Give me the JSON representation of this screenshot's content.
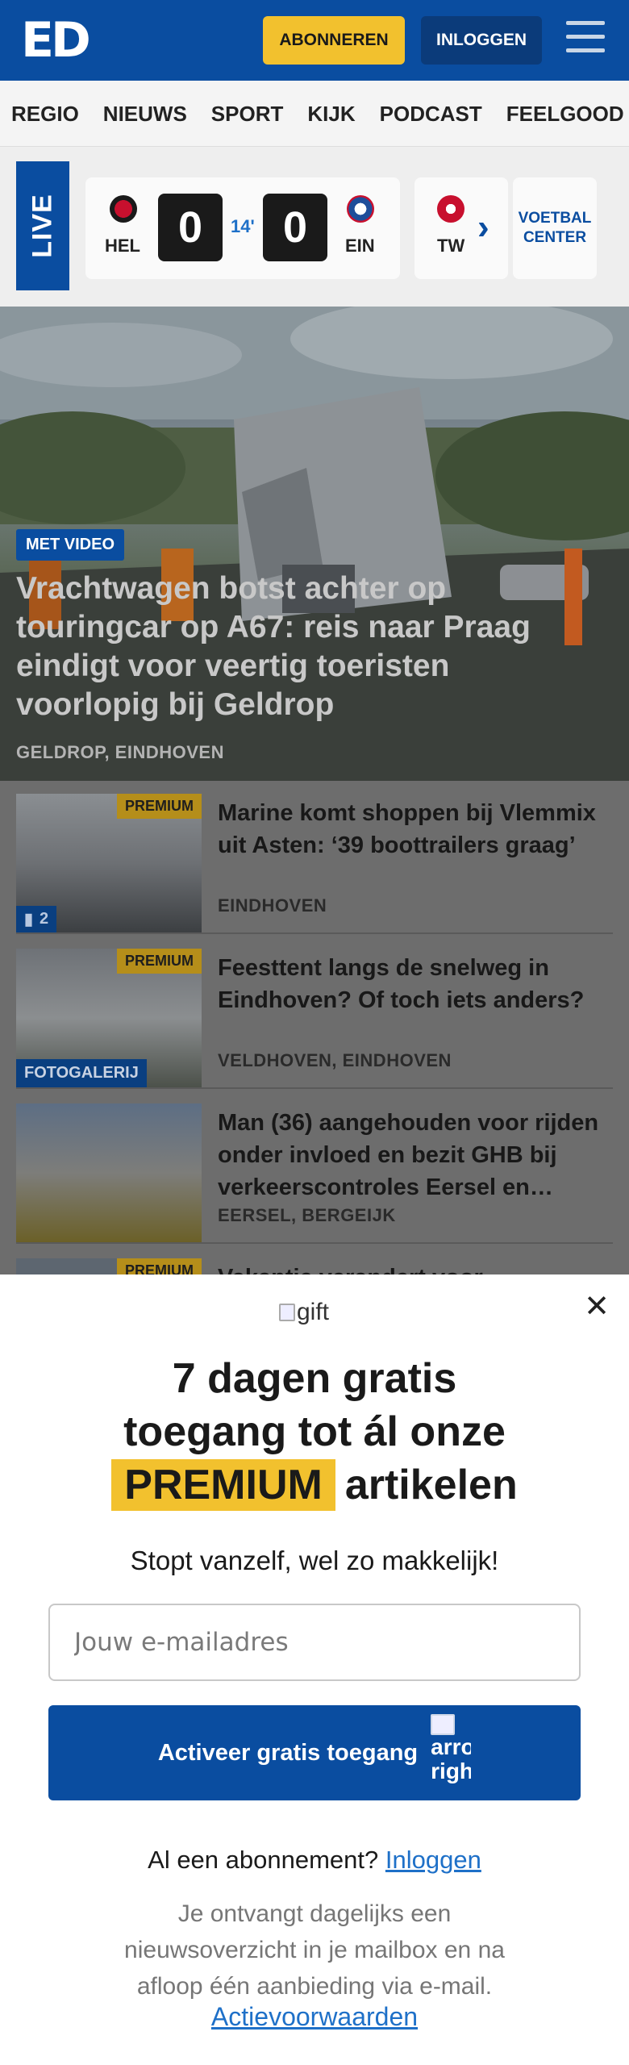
{
  "header": {
    "logo": "ED",
    "subscribe_label": "ABONNEREN",
    "login_label": "INLOGGEN",
    "menu_icon": "hamburger-icon",
    "brand_color": "#0a4da0",
    "accent_color": "#f2c12e"
  },
  "nav": {
    "items": [
      "REGIO",
      "NIEUWS",
      "SPORT",
      "KIJK",
      "PODCAST",
      "FEELGOOD"
    ]
  },
  "live": {
    "label": "LIVE",
    "match": {
      "home_code": "HEL",
      "home_score": "0",
      "minute": "14'",
      "away_score": "0",
      "away_code": "EIN"
    },
    "next_team_code": "TW",
    "more_icon": "chevron-right-icon",
    "center_label": "VOETBAL CENTER"
  },
  "hero": {
    "badge": "MET VIDEO",
    "title": "Vrachtwagen botst achter op touringcar op A67: reis naar Praag eindigt voor veertig toeristen voorlopig bij Geldrop",
    "location": "GELDROP, EINDHOVEN"
  },
  "articles": [
    {
      "premium": "PREMIUM",
      "comments": "2",
      "title": "Marine komt shoppen bij Vlemmix uit Asten: ‘39 boottrai­lers graag’",
      "location": "EINDHOVEN"
    },
    {
      "premium": "PREMIUM",
      "tag": "FOTOGALERIJ",
      "title": "Feesttent langs de snelweg in Eindhoven? Of toch iets anders?",
      "location": "VELDHOVEN, EINDHOVEN"
    },
    {
      "title": "Man (36) aangehouden voor rijden onder invloed en bezit GHB bij verkeerscontroles Eersel en…",
      "location": "EERSEL, BERGEIJK"
    },
    {
      "premium": "PREMIUM",
      "title": "Vakantie verandert voor"
    }
  ],
  "modal": {
    "gift_alt": "gift",
    "headline_line1": "7 dagen gratis",
    "headline_line2": "toegang tot ál onze",
    "headline_premium": "PREMIUM",
    "headline_end": "artikelen",
    "subline": "Stopt vanzelf, wel zo makkelijk!",
    "email_placeholder": "Jouw e-mailadres",
    "cta_label": "Activeer gratis toegang",
    "cta_icon_alt": "arrow right",
    "already_text": "Al een abonnement?",
    "login_link": "Inloggen",
    "info_text": "Je ontvangt dagelijks een nieuwsoverzicht in je mailbox en na afloop één aanbieding via e-mail.",
    "terms_link": "Actievoorwaarden",
    "close_icon": "close-icon"
  }
}
